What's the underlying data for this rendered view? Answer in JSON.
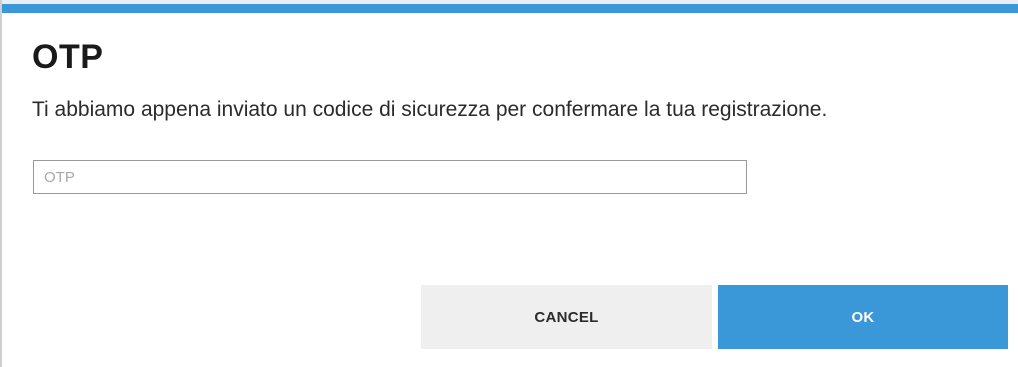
{
  "dialog": {
    "title": "OTP",
    "message": "Ti abbiamo appena inviato un codice di sicurezza per confermare la tua registrazione.",
    "otp_input": {
      "value": "",
      "placeholder": "OTP"
    },
    "buttons": {
      "cancel_label": "CANCEL",
      "ok_label": "OK"
    }
  },
  "colors": {
    "accent": "#3a97d8",
    "cancel_bg": "#efefef"
  }
}
